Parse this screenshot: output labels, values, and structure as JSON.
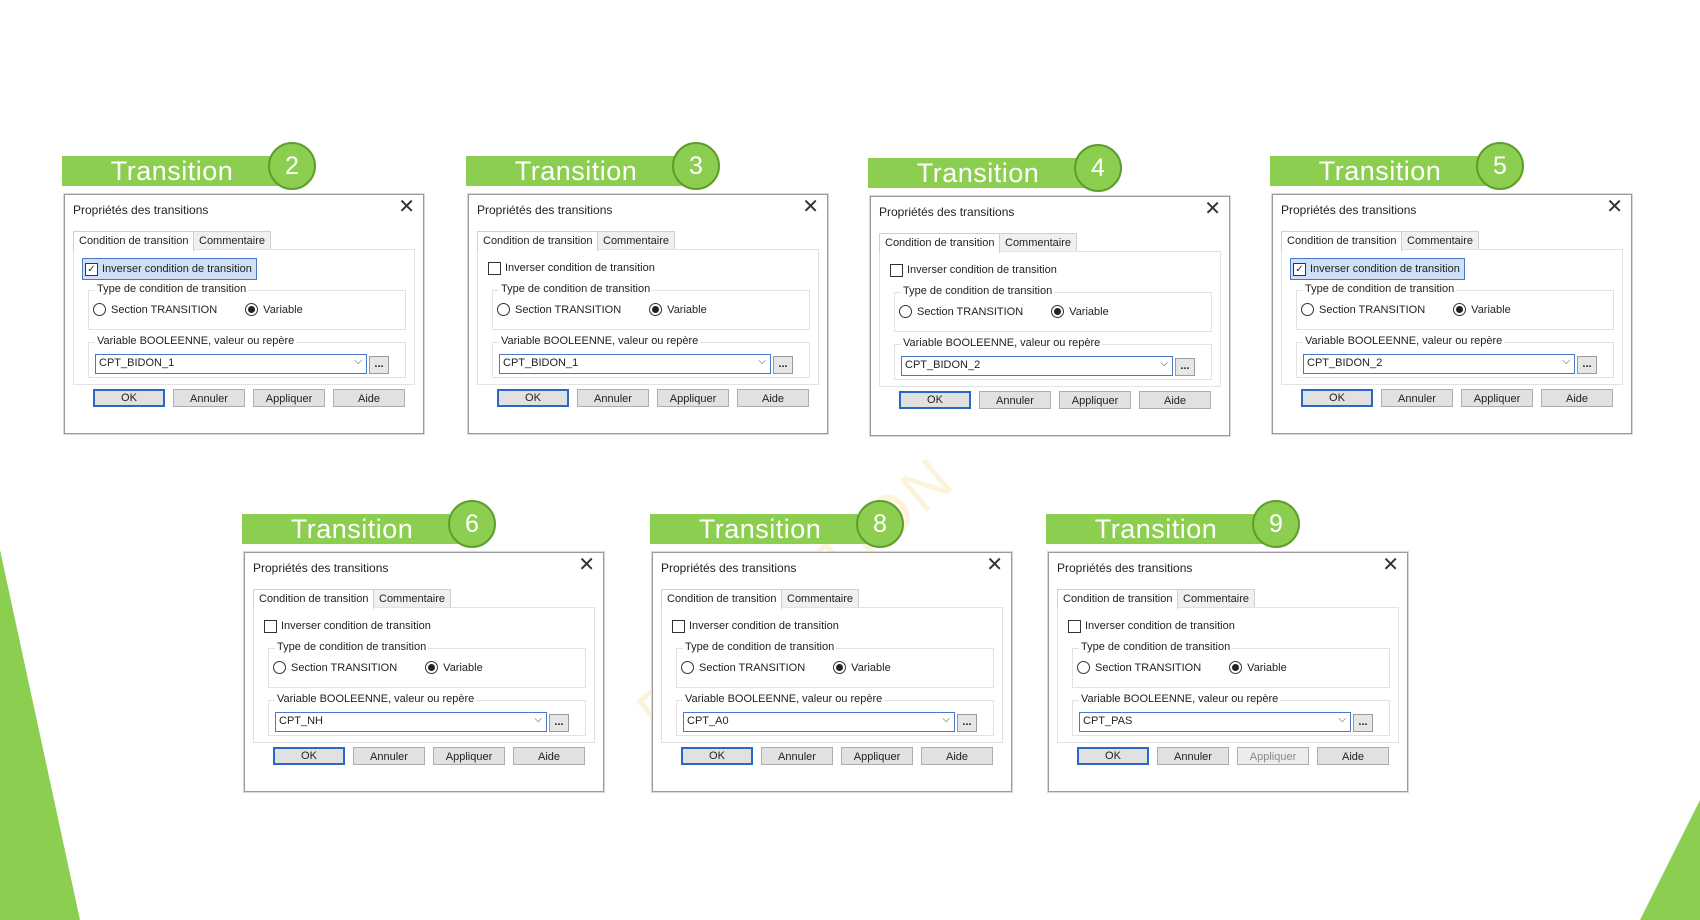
{
  "dialog_title": "Propriétés des transitions",
  "tab_condition": "Condition de transition",
  "tab_comment": "Commentaire",
  "check_label": "Inverser condition de transition",
  "group_type_label": "Type de condition de transition",
  "radio_section": "Section TRANSITION",
  "radio_variable": "Variable",
  "group_var_label": "Variable BOOLEENNE, valeur ou repère",
  "browse_label": "...",
  "buttons": {
    "ok": "OK",
    "cancel": "Annuler",
    "apply": "Appliquer",
    "help": "Aide"
  },
  "banner_label": "Transition",
  "watermark_text": "FORMATION",
  "panels": [
    {
      "number": "2",
      "checked": true,
      "value": "CPT_BIDON_1",
      "apply_disabled": false
    },
    {
      "number": "3",
      "checked": false,
      "value": "CPT_BIDON_1",
      "apply_disabled": false
    },
    {
      "number": "4",
      "checked": false,
      "value": "CPT_BIDON_2",
      "apply_disabled": false
    },
    {
      "number": "5",
      "checked": true,
      "value": "CPT_BIDON_2",
      "apply_disabled": false
    },
    {
      "number": "6",
      "checked": false,
      "value": "CPT_NH",
      "apply_disabled": false
    },
    {
      "number": "8",
      "checked": false,
      "value": "CPT_A0",
      "apply_disabled": false
    },
    {
      "number": "9",
      "checked": false,
      "value": "CPT_PAS",
      "apply_disabled": true
    }
  ],
  "colors": {
    "accent_green": "#8ccf50",
    "select_blue": "#4a78c4"
  }
}
